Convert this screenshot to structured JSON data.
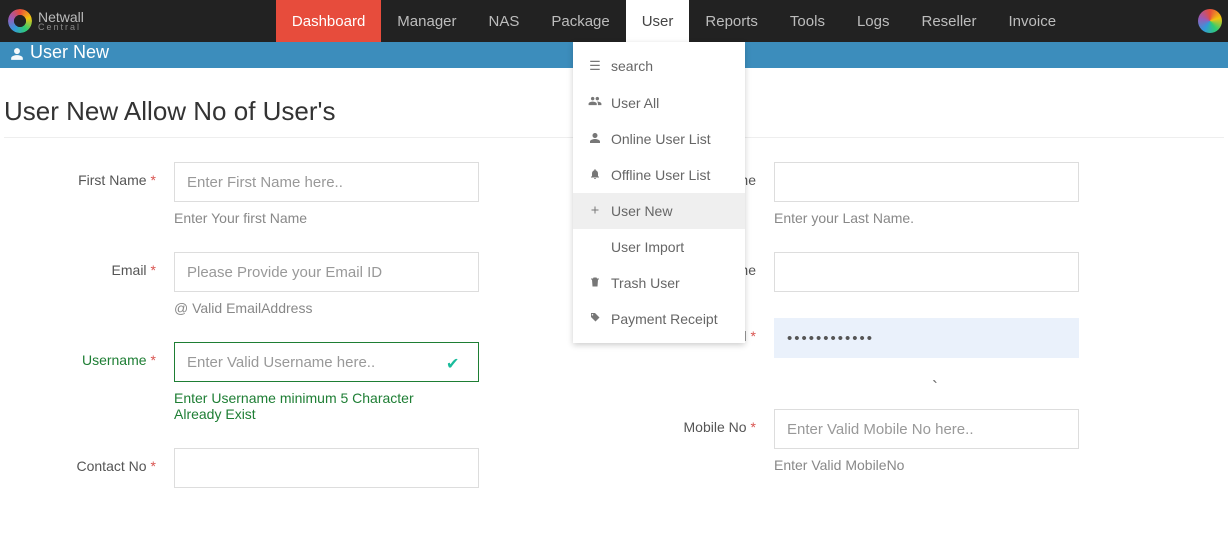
{
  "brand": {
    "line1": "Netwall",
    "line2": "Central"
  },
  "nav": {
    "dashboard": "Dashboard",
    "manager": "Manager",
    "nas": "NAS",
    "package": "Package",
    "user": "User",
    "reports": "Reports",
    "tools": "Tools",
    "logs": "Logs",
    "reseller": "Reseller",
    "invoice": "Invoice"
  },
  "pagebar": {
    "title": "User New"
  },
  "dropdown": {
    "search": "search",
    "user_all": "User All",
    "online": "Online User List",
    "offline": "Offline User List",
    "user_new": "User New",
    "user_import": "User Import",
    "trash": "Trash User",
    "payment": "Payment Receipt"
  },
  "heading": "User New Allow No of User's",
  "form": {
    "first_name": {
      "label": "First Name",
      "placeholder": "Enter First Name here..",
      "help": "Enter Your first Name"
    },
    "last_name": {
      "label": "Last Name",
      "help": "Enter your Last Name."
    },
    "email": {
      "label": "Email",
      "placeholder": "Please Provide your Email ID",
      "help": "@ Valid EmailAddress"
    },
    "company": {
      "label": "Company Name"
    },
    "username": {
      "label": "Username",
      "placeholder": "Enter Valid Username here..",
      "help": "Enter Username minimum 5 Character Already Exist"
    },
    "password": {
      "label": "Password",
      "value": "••••••••••••"
    },
    "contact": {
      "label": "Contact No"
    },
    "mobile": {
      "label": "Mobile No",
      "placeholder": "Enter Valid Mobile No here..",
      "help": "Enter Valid MobileNo"
    }
  }
}
